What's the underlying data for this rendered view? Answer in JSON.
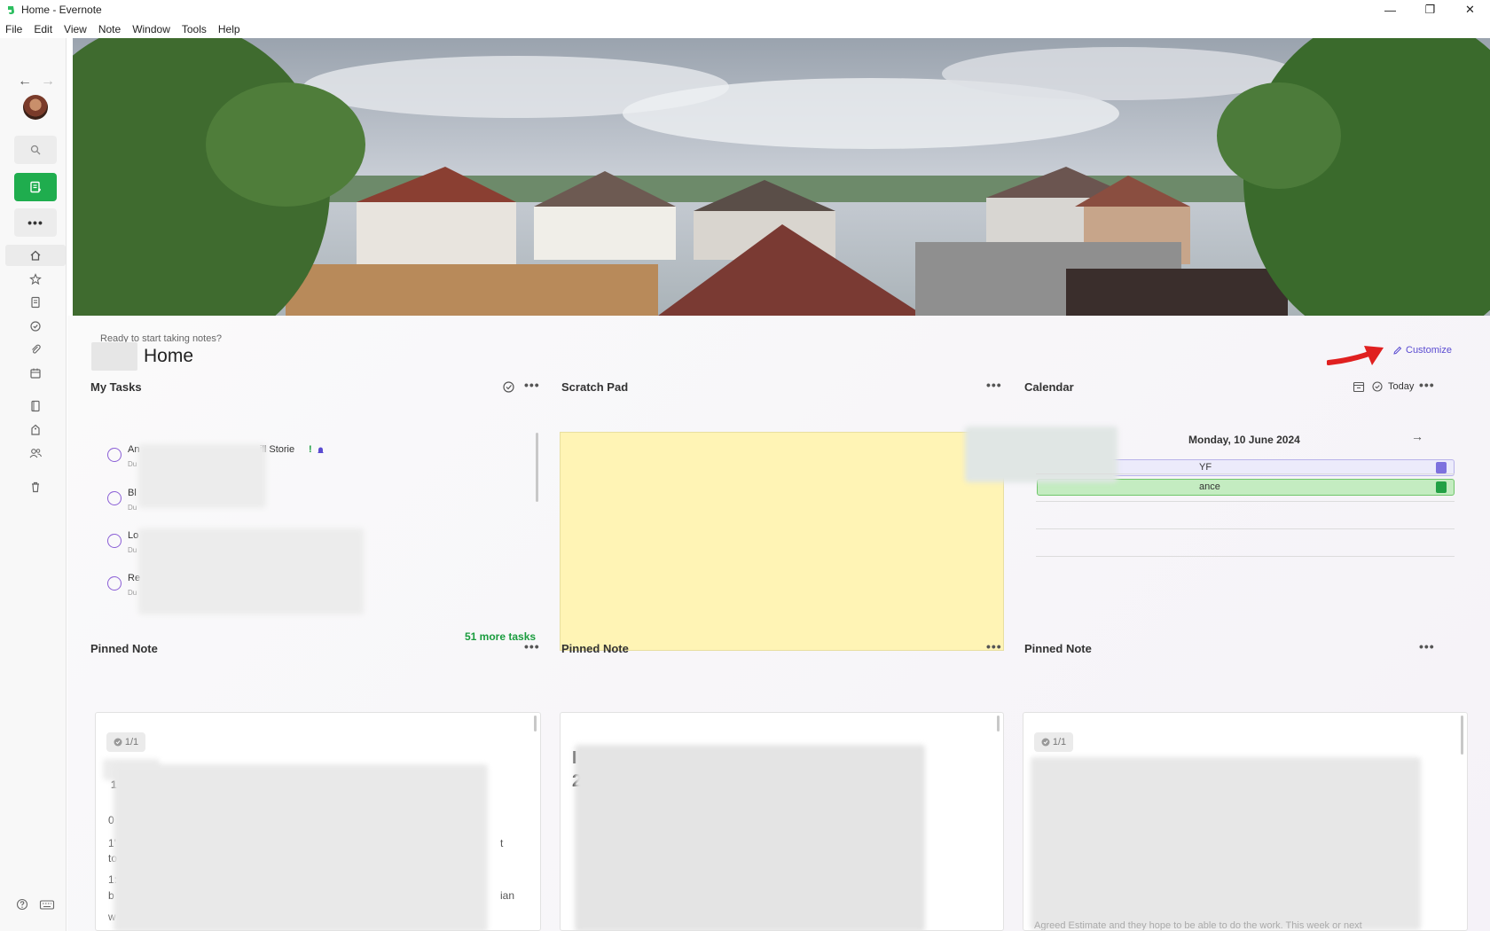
{
  "window": {
    "title": "Home - Evernote",
    "minimize": "—",
    "maximize": "❐",
    "close": "✕"
  },
  "menu": [
    "File",
    "Edit",
    "View",
    "Note",
    "Window",
    "Tools",
    "Help"
  ],
  "sidebar": {
    "icons": [
      "back-icon",
      "forward-icon",
      "search-icon",
      "new-note-icon",
      "more-icon",
      "home-icon",
      "shortcuts-icon",
      "notes-icon",
      "tasks-icon",
      "files-icon",
      "calendar-icon",
      "notebooks-icon",
      "tags-icon",
      "shared-icon",
      "trash-icon",
      "help-icon",
      "keyboard-icon"
    ],
    "accent": "#1fad4e"
  },
  "home": {
    "greeting": "Ready to start taking notes?",
    "title": "Home",
    "customize": "Customize"
  },
  "tasks": {
    "title": "My Tasks",
    "items": [
      {
        "title": "An",
        "suffix": "ill Storie",
        "due": "Du"
      },
      {
        "title": "Bl",
        "suffix": "",
        "due": "Du"
      },
      {
        "title": "Lo",
        "suffix": "",
        "due": "Du"
      },
      {
        "title": "Re",
        "suffix": "",
        "due": "Du"
      }
    ],
    "more": "51 more tasks"
  },
  "scratch": {
    "title": "Scratch Pad",
    "color": "#fff4b5"
  },
  "calendar": {
    "title": "Calendar",
    "today": "Today",
    "date": "Monday, 10 June 2024",
    "events": [
      {
        "text": "YF",
        "color": "#ecebfb"
      },
      {
        "text": "ance",
        "color": "#c4ecc1"
      }
    ]
  },
  "pinned": [
    {
      "title": "Pinned Note",
      "badge": "1/1",
      "snippets": [
        "1",
        "0",
        "1'",
        "t",
        "to",
        "1:",
        "b",
        "ian",
        "W"
      ]
    },
    {
      "title": "Pinned Note",
      "badge": "",
      "snippets": [
        "I",
        "2"
      ]
    },
    {
      "title": "Pinned Note",
      "badge": "1/1",
      "snippets": [
        "Agreed Estimate and they hope to be able to do the work. This week or next"
      ]
    }
  ]
}
